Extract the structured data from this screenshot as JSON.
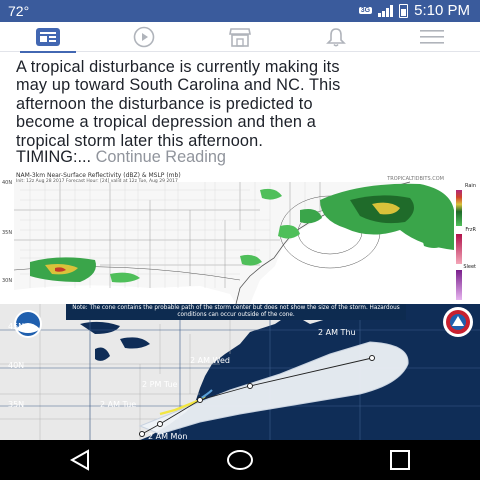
{
  "status_bar": {
    "temperature": "72°",
    "network": "3G",
    "time": "5:10 PM"
  },
  "tabs": [
    {
      "name": "news-feed",
      "icon": "news-feed-icon",
      "active": true
    },
    {
      "name": "video",
      "icon": "play-icon",
      "active": false
    },
    {
      "name": "marketplace",
      "icon": "shop-icon",
      "active": false
    },
    {
      "name": "notifications",
      "icon": "bell-icon",
      "active": false
    },
    {
      "name": "menu",
      "icon": "hamburger-menu-icon",
      "active": false
    }
  ],
  "post": {
    "lines": [
      "A tropical disturbance is currently making its",
      "may up toward South Carolina and NC.  This",
      "afternoon the disturbance is predicted to",
      "become a tropical depression and then a",
      "tropical storm later this afternoon."
    ],
    "timing_prefix": "TIMING:...",
    "continue_label": "Continue Reading"
  },
  "radar_map": {
    "title": "NAM-3km Near-Surface Reflectivity (dBZ) & MSLP (mb)",
    "subtitle": "Init: 12z Aug 28 2017   Forecast Hour: [24]   valid at 12z Tue, Aug 29 2017",
    "site": "TROPICALTIDBITS.COM",
    "lat_labels": [
      "40N",
      "35N",
      "30N"
    ],
    "legend": [
      "Rain",
      "FrzR",
      "Sleet"
    ]
  },
  "cone_map": {
    "note": "Note: The cone contains the probable path of the storm center but does not show the size of the storm. Hazardous conditions can occur outside of the cone.",
    "lat_labels": [
      "45N",
      "40N",
      "35N"
    ],
    "forecast_points": [
      "2 AM Thu",
      "2 AM Wed",
      "2 PM Tue",
      "2 AM Tue",
      "2 AM Mon"
    ]
  },
  "nav_bar": {
    "buttons": [
      "back-icon",
      "home-icon",
      "recents-icon"
    ]
  },
  "colors": {
    "status_bar": "#3a5b9c",
    "accent": "#4267b2",
    "ocean": "#0f2d57",
    "land": "#ebebeb",
    "cone": "#eef2f7"
  }
}
